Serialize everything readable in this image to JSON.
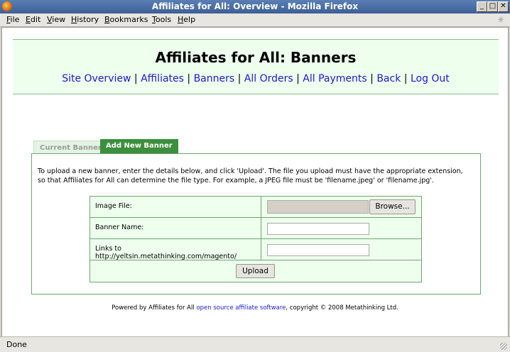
{
  "window": {
    "title": "Affiliates for All: Overview - Mozilla Firefox",
    "minimize": "_",
    "maximize": "□",
    "close": "✕"
  },
  "menu": [
    "File",
    "Edit",
    "View",
    "History",
    "Bookmarks",
    "Tools",
    "Help"
  ],
  "page": {
    "title": "Affiliates for All: Banners",
    "nav": [
      "Site Overview",
      "Affiliates",
      "Banners",
      "All Orders",
      "All Payments",
      "Back",
      "Log Out"
    ],
    "nav_separator": "|"
  },
  "tabs": {
    "current": "Current Banners",
    "add_new": "Add New Banner"
  },
  "panel": {
    "instructions": "To upload a new banner, enter the details below, and click 'Upload'. The file you upload must have the appropriate extension, so that Affiliates for All can determine the file type. For example, a JPEG file must be 'filename.jpeg' or 'filename.jpg'.",
    "fields": {
      "image_file": "Image File:",
      "banner_name": "Banner Name:",
      "links_to": "Links to http://yeltsin.metathinking.com/magento/"
    },
    "browse_label": "Browse...",
    "upload_label": "Upload"
  },
  "footer": {
    "prefix": "Powered by Affiliates for All ",
    "link": "open source affiliate software",
    "suffix": ", copyright © 2008 Metathinking Ltd."
  },
  "status": {
    "text": "Done"
  }
}
